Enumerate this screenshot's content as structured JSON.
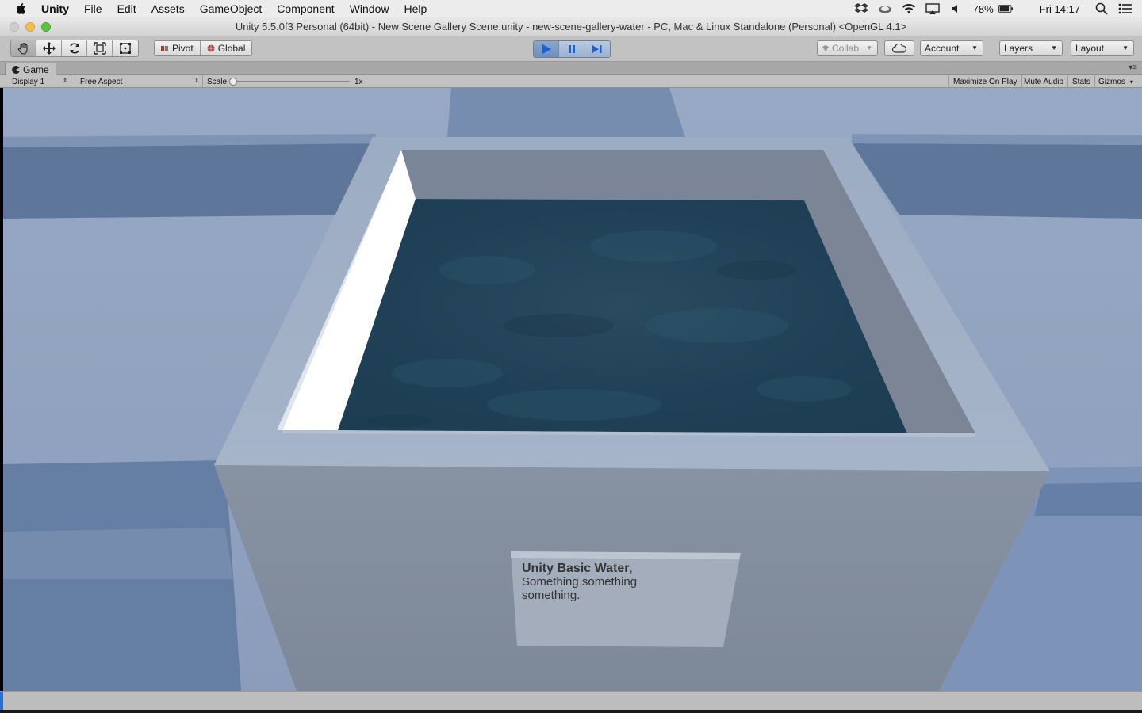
{
  "menubar": {
    "app_name": "Unity",
    "items": [
      "File",
      "Edit",
      "Assets",
      "GameObject",
      "Component",
      "Window",
      "Help"
    ],
    "battery": "78%",
    "clock": "Fri 14:17",
    "status_icons": [
      "dropbox-icon",
      "cloud-icon",
      "wifi-icon",
      "airplay-icon",
      "volume-icon",
      "battery-icon",
      "spotlight-icon",
      "notification-center-icon"
    ]
  },
  "window": {
    "title": "Unity 5.5.0f3 Personal (64bit) - New Scene Gallery Scene.unity - new-scene-gallery-water - PC, Mac & Linux Standalone (Personal) <OpenGL 4.1>"
  },
  "toolbar": {
    "transform_tools": [
      "hand-tool",
      "move-tool",
      "rotate-tool",
      "scale-tool",
      "rect-tool"
    ],
    "pivot_label": "Pivot",
    "global_label": "Global",
    "collab_label": "Collab",
    "account_label": "Account",
    "layers_label": "Layers",
    "layout_label": "Layout"
  },
  "game_view": {
    "tab_label": "Game",
    "display": "Display 1",
    "aspect": "Free Aspect",
    "scale_label": "Scale",
    "scale_value": "1x",
    "maximize_label": "Maximize On Play",
    "mute_label": "Mute Audio",
    "stats_label": "Stats",
    "gizmos_label": "Gizmos"
  },
  "scene": {
    "plaque_title": "Unity Basic Water",
    "plaque_title_suffix": ",",
    "plaque_line2": "Something something",
    "plaque_line3": "something.",
    "colors": {
      "water": "#1f3f54",
      "sky": "#8fa2c0",
      "box": "#9aa7bb"
    }
  }
}
